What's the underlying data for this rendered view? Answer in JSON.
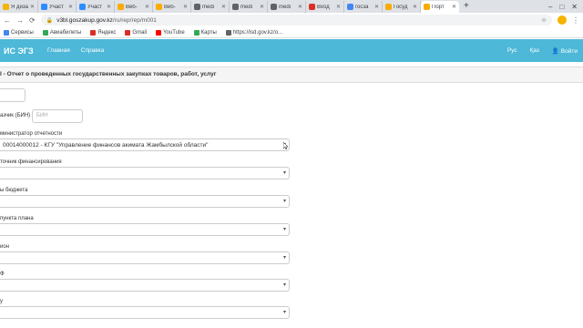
{
  "browser": {
    "tabs": [
      {
        "label": "Я дизай",
        "color": "#f4b400",
        "active": false
      },
      {
        "label": "Участ",
        "color": "#2d8cff",
        "active": false
      },
      {
        "label": "Участ",
        "color": "#2d8cff",
        "active": false
      },
      {
        "label": "Веб-",
        "color": "#f9ab00",
        "active": false
      },
      {
        "label": "Веб-",
        "color": "#f9ab00",
        "active": false
      },
      {
        "label": "medi",
        "color": "#5f6368",
        "active": false
      },
      {
        "label": "medi",
        "color": "#5f6368",
        "active": false
      },
      {
        "label": "medi",
        "color": "#5f6368",
        "active": false
      },
      {
        "label": "Вход",
        "color": "#d93025",
        "active": false
      },
      {
        "label": "госза",
        "color": "#4285f4",
        "active": false
      },
      {
        "label": "Госуд",
        "color": "#f9ab00",
        "active": false
      },
      {
        "label": "Порт",
        "color": "#f9ab00",
        "active": true
      }
    ],
    "new_tab_icon": "+",
    "window_controls": [
      "–",
      "□",
      "✕"
    ],
    "url_host": "v3bl.goszakup.gov.kz",
    "url_path": "/ru/rep/rep/m001",
    "back_icon": "←",
    "forward_icon": "→",
    "reload_icon": "⟳",
    "star_icon": "☆",
    "menu_icon": "⋮",
    "bookmarks": [
      {
        "label": "Сервисы",
        "color": "#4285f4"
      },
      {
        "label": "Авиабилеты",
        "color": "#34a853"
      },
      {
        "label": "Яндекс",
        "color": "#d93025"
      },
      {
        "label": "Gmail",
        "color": "#d93025"
      },
      {
        "label": "YouTube",
        "color": "#ff0000"
      },
      {
        "label": "Карты",
        "color": "#34a853"
      },
      {
        "label": "https://isd.gov.kz/o...",
        "color": "#5f6368"
      }
    ]
  },
  "app": {
    "brand": "ИС ЭГЗ",
    "nav": [
      "Главная",
      "Справка"
    ],
    "lang_ru": "Рус",
    "lang_kz": "Қаз",
    "login_label": "Войти",
    "login_icon": "user-icon",
    "accent_color": "#4db8d8"
  },
  "page": {
    "title": "I - Отчет о проведенных государственных закупках товаров, работ, услуг",
    "fields": {
      "customer_label": "азчик (БИН)",
      "bin_placeholder": "БИН",
      "admin_label": "министратор отчетности",
      "admin_value": "00014000012 - КГУ \"Управление финансов акимата Жамбылской области\"",
      "funding_label": "точник финансирования",
      "budget_label": "ы бюджета",
      "plan_label": "пункта плана",
      "region_label": "ион",
      "ktf_label": "Ф",
      "last_label": "у"
    }
  }
}
